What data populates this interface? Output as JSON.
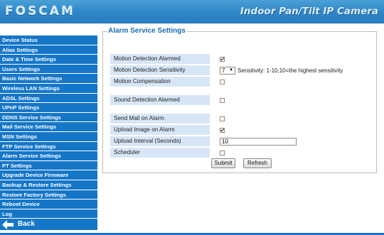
{
  "header": {
    "logo": "FOSCAM",
    "title": "Indoor Pan/Tilt IP Camera"
  },
  "sidebar": {
    "items": [
      "Device Status",
      "Alias Settings",
      "Date & Time Settings",
      "Users Settings",
      "Basic Network Settings",
      "Wireless LAN Settings",
      "ADSL Settings",
      "UPnP Settings",
      "DDNS Service Settings",
      "Mail Service Settings",
      "MSN Settings",
      "FTP Service Settings",
      "Alarm Service Settings",
      "PT Settings",
      "Upgrade Device Firmware",
      "Backup & Restore Settings",
      "Restore Factory Settings",
      "Reboot Device",
      "Log"
    ],
    "back_label": "Back"
  },
  "panel": {
    "legend": "Alarm Service Settings",
    "motion_alarmed": {
      "label": "Motion Detection Alarmed",
      "checked": true
    },
    "motion_sensitivity": {
      "label": "Motion Detection Sensitivity",
      "value": "7",
      "hint": "Sensitivity: 1-10,10=the highest sensitivity"
    },
    "motion_compensation": {
      "label": "Motion Compensation",
      "checked": false
    },
    "sound_alarmed": {
      "label": "Sound Detection Alarmed",
      "checked": false
    },
    "send_mail": {
      "label": "Send Mail on Alarm",
      "checked": false
    },
    "upload_image": {
      "label": "Upload Image on Alarm",
      "checked": true
    },
    "upload_interval": {
      "label": "Upload Interval (Seconds)",
      "value": "10"
    },
    "scheduler": {
      "label": "Scheduler",
      "checked": false
    },
    "submit_label": "Submit",
    "refresh_label": "Refresh"
  },
  "colors": {
    "header": "#2f86c7",
    "nav": "#1576c8",
    "label_bg": "#d7e6f6",
    "legend": "#1a6cb4"
  }
}
